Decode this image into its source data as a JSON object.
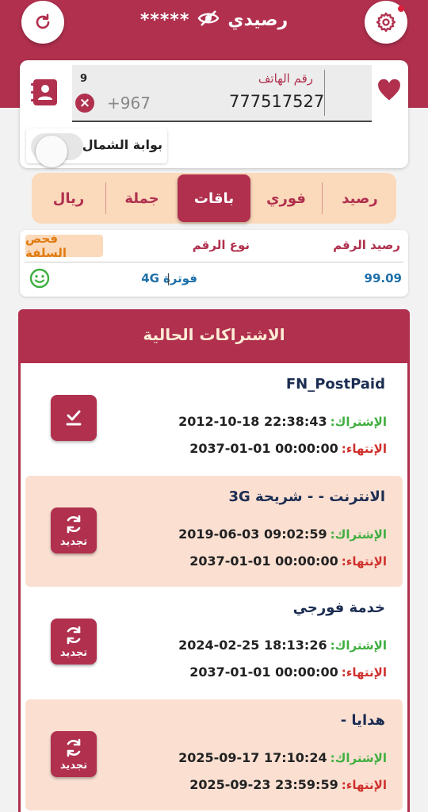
{
  "header": {
    "title": "رصيدي",
    "masked_balance": "*****"
  },
  "phone": {
    "label": "رقم الهاتف",
    "number": "777517527",
    "prefix": "+967",
    "length": "9",
    "clear_symbol": "×"
  },
  "toggle": {
    "label": "بوابة الشمال",
    "on": false
  },
  "tabs": [
    {
      "label": "رصيد",
      "active": false
    },
    {
      "label": "فوري",
      "active": false
    },
    {
      "label": "باقات",
      "active": true
    },
    {
      "label": "جملة",
      "active": false
    },
    {
      "label": "ريال",
      "active": false
    }
  ],
  "info": {
    "balance_header": "رصيد الرقم",
    "type_header": "نوع الرقم",
    "check_label": "فحص السلفة",
    "balance_value": "99.09",
    "type_value": "فوترة",
    "network": "4G"
  },
  "subscriptions": {
    "title": "الاشتراكات الحالية",
    "start_label": "الإشتراك:",
    "end_label": "الإنتهاء:",
    "renew_label": "تجديد",
    "items": [
      {
        "name": "FN_PostPaid",
        "start": "2012-10-18 22:38:43",
        "end": "2037-01-01 00:00:00",
        "icon": "checkmark-icon"
      },
      {
        "name": "الانترنت - - شريحة 3G",
        "start": "2019-06-03 09:02:59",
        "end": "2037-01-01 00:00:00",
        "icon": "renew-icon"
      },
      {
        "name": "خدمة فورجي",
        "start": "2024-02-25 18:13:26",
        "end": "2037-01-01 00:00:00",
        "icon": "renew-icon"
      },
      {
        "name": "هدايا -",
        "start": "2025-09-17 17:10:24",
        "end": "2025-09-23 23:59:59",
        "icon": "renew-icon"
      }
    ]
  },
  "colors": {
    "brand": "#b0304e",
    "tab_bg": "#fbd9bb",
    "start_label": "#3fae3f",
    "end_label": "#d0302c",
    "value_blue": "#1d6fa8"
  }
}
